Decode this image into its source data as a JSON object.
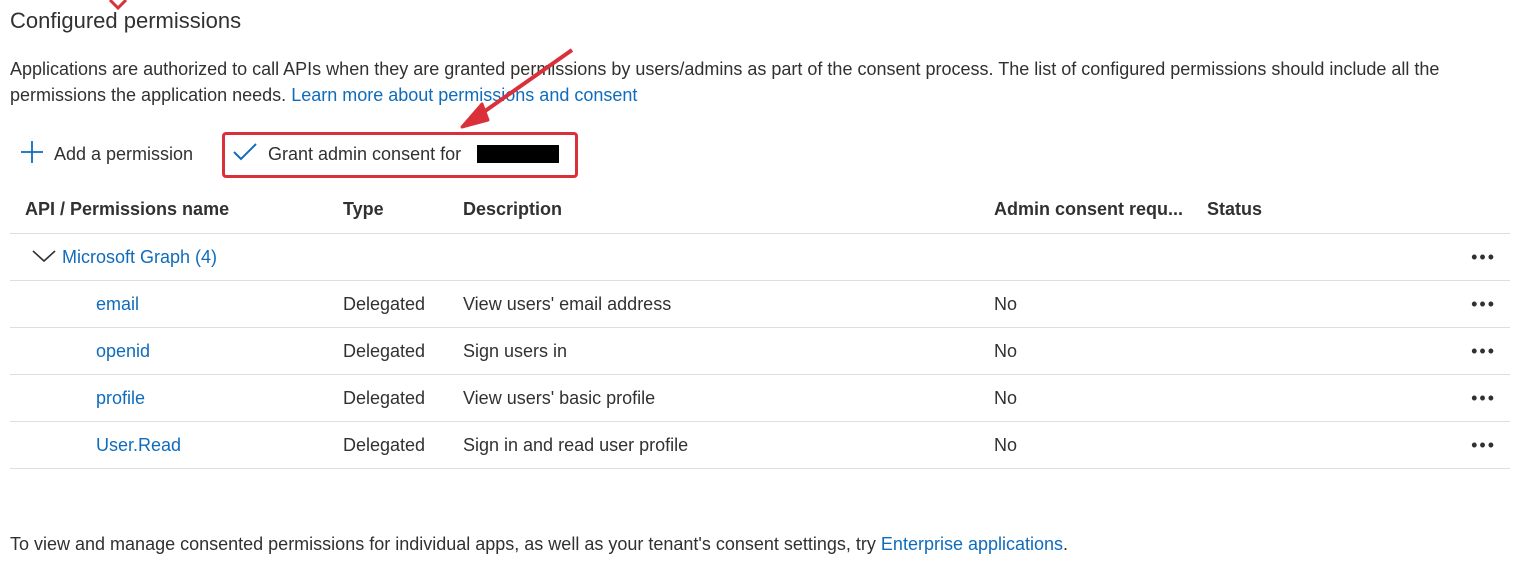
{
  "section": {
    "title": "Configured permissions",
    "description": "Applications are authorized to call APIs when they are granted permissions by users/admins as part of the consent process. The list of configured permissions should include all the permissions the application needs.",
    "learn_more": "Learn more about permissions and consent"
  },
  "toolbar": {
    "add_label": "Add a permission",
    "grant_label": "Grant admin consent for"
  },
  "table": {
    "headers": [
      "API / Permissions name",
      "Type",
      "Description",
      "Admin consent requ...",
      "Status"
    ],
    "group": {
      "name": "Microsoft Graph (4)"
    },
    "rows": [
      {
        "name": "email",
        "type": "Delegated",
        "description": "View users' email address",
        "admin_consent": "No",
        "status": ""
      },
      {
        "name": "openid",
        "type": "Delegated",
        "description": "Sign users in",
        "admin_consent": "No",
        "status": ""
      },
      {
        "name": "profile",
        "type": "Delegated",
        "description": "View users' basic profile",
        "admin_consent": "No",
        "status": ""
      },
      {
        "name": "User.Read",
        "type": "Delegated",
        "description": "Sign in and read user profile",
        "admin_consent": "No",
        "status": ""
      }
    ],
    "more_label": "•••"
  },
  "footer": {
    "text": "To view and manage consented permissions for individual apps, as well as your tenant's consent settings, try",
    "link": "Enterprise applications",
    "suffix": "."
  },
  "colors": {
    "accent": "#0f6cbd",
    "highlight": "#d9303a"
  },
  "icons": [
    "plus-icon",
    "checkmark-icon",
    "chevron-down-icon",
    "more-icon",
    "annotation-arrow"
  ]
}
